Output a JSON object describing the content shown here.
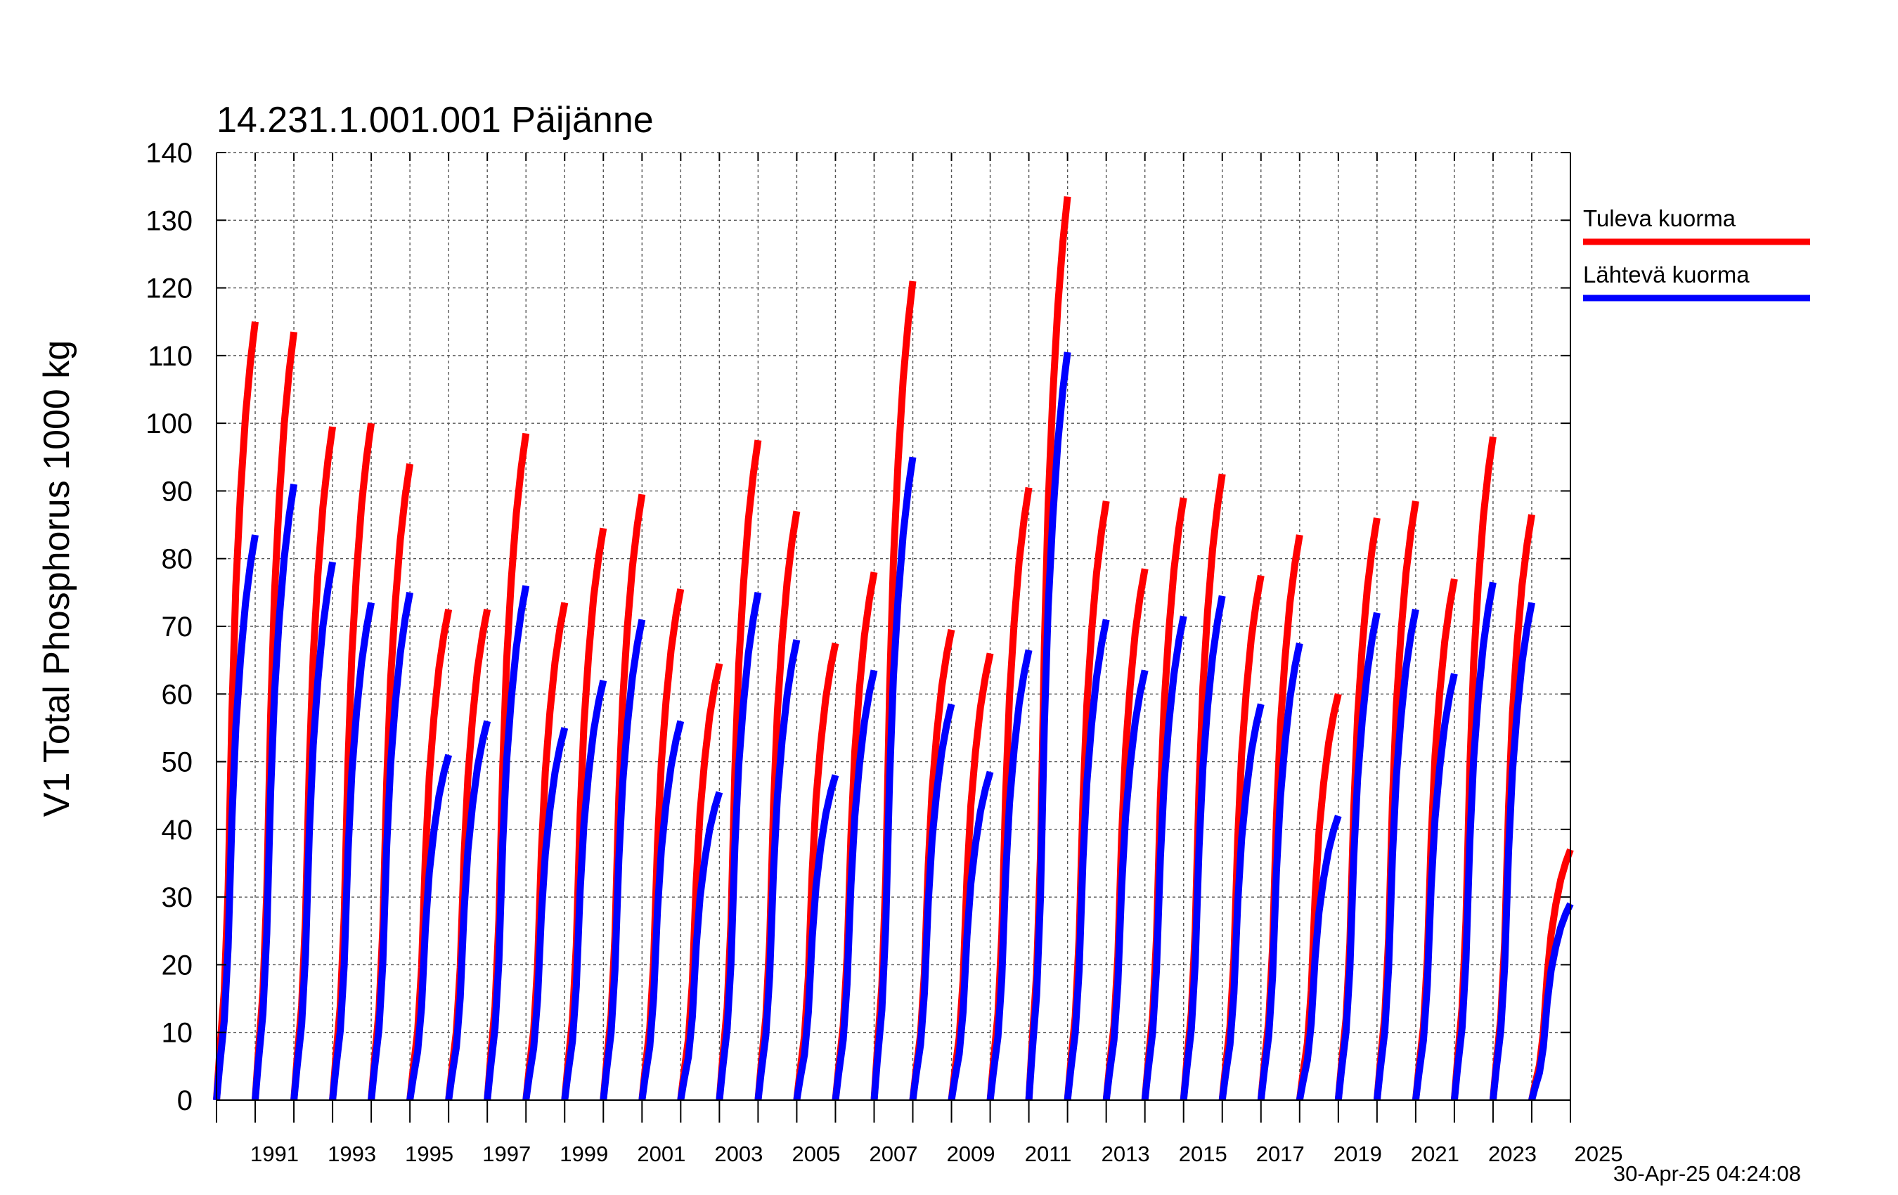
{
  "chart_data": {
    "type": "line",
    "title": "14.231.1.001.001 Päijänne",
    "ylabel": "V1 Total Phosphorus 1000 kg",
    "xlabel": "",
    "ylim": [
      0,
      140
    ],
    "xlim": [
      1990,
      2025
    ],
    "yticks": [
      "0",
      "10",
      "20",
      "30",
      "40",
      "50",
      "60",
      "70",
      "80",
      "90",
      "100",
      "110",
      "120",
      "130",
      "140"
    ],
    "xtick_labels": [
      "1991",
      "1993",
      "1995",
      "1997",
      "1999",
      "2001",
      "2003",
      "2005",
      "2007",
      "2009",
      "2011",
      "2013",
      "2015",
      "2017",
      "2019",
      "2021",
      "2023",
      "2025"
    ],
    "grid": true,
    "legend_position": "right",
    "timestamp": "30-Apr-25 04:24:08",
    "series": [
      {
        "name": "Tuleva kuorma",
        "color": "#ff0000",
        "years": [
          1990,
          1991,
          1992,
          1993,
          1994,
          1995,
          1996,
          1997,
          1998,
          1999,
          2000,
          2001,
          2002,
          2003,
          2004,
          2005,
          2006,
          2007,
          2008,
          2009,
          2010,
          2011,
          2012,
          2013,
          2014,
          2015,
          2016,
          2017,
          2018,
          2019,
          2020,
          2021,
          2022,
          2023,
          2024,
          2025
        ],
        "annual_totals": [
          115,
          113.5,
          99.5,
          100,
          94,
          72.5,
          72.5,
          98.5,
          73.5,
          84.5,
          89.5,
          75.5,
          64.5,
          97.5,
          87,
          67.5,
          78,
          121,
          69.5,
          66,
          90.5,
          133.5,
          88.5,
          78.5,
          89,
          92.5,
          77.5,
          83.5,
          60,
          86,
          88.5,
          77,
          98,
          86.5,
          37
        ]
      },
      {
        "name": "Lähtevä kuorma",
        "color": "#0000ff",
        "years": [
          1990,
          1991,
          1992,
          1993,
          1994,
          1995,
          1996,
          1997,
          1998,
          1999,
          2000,
          2001,
          2002,
          2003,
          2004,
          2005,
          2006,
          2007,
          2008,
          2009,
          2010,
          2011,
          2012,
          2013,
          2014,
          2015,
          2016,
          2017,
          2018,
          2019,
          2020,
          2021,
          2022,
          2023,
          2024,
          2025
        ],
        "annual_totals": [
          83.5,
          91,
          79.5,
          73.5,
          75,
          51,
          56,
          76,
          55,
          62,
          71,
          56,
          45.5,
          75,
          68,
          48,
          63.5,
          95,
          58.5,
          48.5,
          66.5,
          110.5,
          71,
          63.5,
          71.5,
          74.5,
          58.5,
          67.5,
          42,
          72,
          72.5,
          63,
          76.5,
          73.5,
          29
        ]
      }
    ]
  }
}
